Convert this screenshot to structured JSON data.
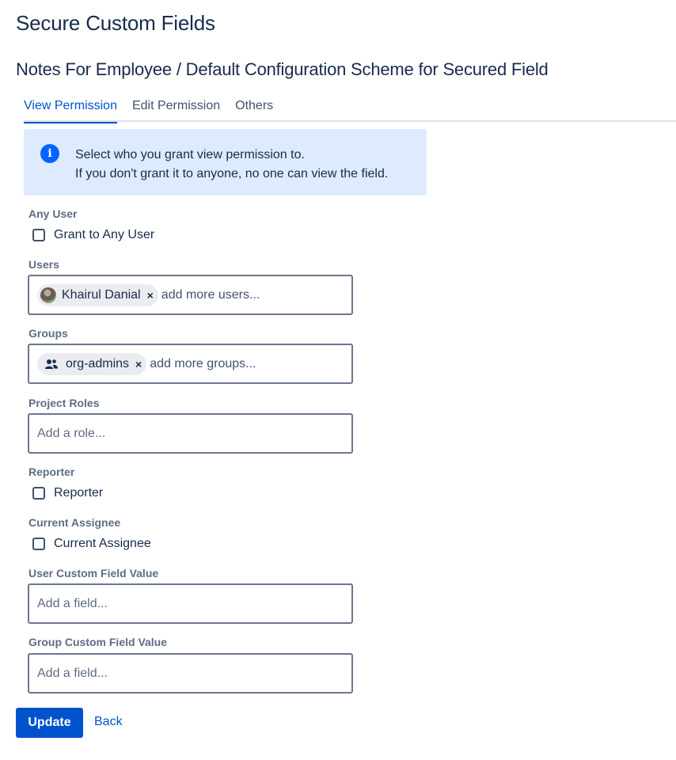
{
  "header": {
    "title": "Secure Custom Fields",
    "subtitle": "Notes For Employee / Default Configuration Scheme for Secured Field"
  },
  "tabs": [
    {
      "label": "View Permission",
      "active": true
    },
    {
      "label": "Edit Permission",
      "active": false
    },
    {
      "label": "Others",
      "active": false
    }
  ],
  "info": {
    "line1": "Select who you grant view permission to.",
    "line2": "If you don't grant it to anyone, no one can view the field."
  },
  "any_user": {
    "label": "Any User",
    "checkbox_label": "Grant to Any User",
    "checked": false
  },
  "users": {
    "label": "Users",
    "tags": [
      {
        "name": "Khairul Danial"
      }
    ],
    "remove_glyph": "×",
    "placeholder": "add more users..."
  },
  "groups": {
    "label": "Groups",
    "tags": [
      {
        "name": "org-admins"
      }
    ],
    "remove_glyph": "×",
    "placeholder": "add more groups..."
  },
  "project_roles": {
    "label": "Project Roles",
    "placeholder": "Add a role..."
  },
  "reporter": {
    "label": "Reporter",
    "checkbox_label": "Reporter",
    "checked": false
  },
  "current_assignee": {
    "label": "Current Assignee",
    "checkbox_label": "Current Assignee",
    "checked": false
  },
  "user_custom_field": {
    "label": "User Custom Field Value",
    "placeholder": "Add a field..."
  },
  "group_custom_field": {
    "label": "Group Custom Field Value",
    "placeholder": "Add a field..."
  },
  "actions": {
    "update": "Update",
    "back": "Back"
  },
  "icons": {
    "info": "info-icon",
    "avatar": "user-avatar",
    "group": "group-icon",
    "remove": "close-icon"
  },
  "colors": {
    "primary": "#0052cc",
    "info_bg": "#deebff",
    "info_icon": "#0065ff",
    "text": "#172b4d",
    "label": "#5e6c84"
  }
}
